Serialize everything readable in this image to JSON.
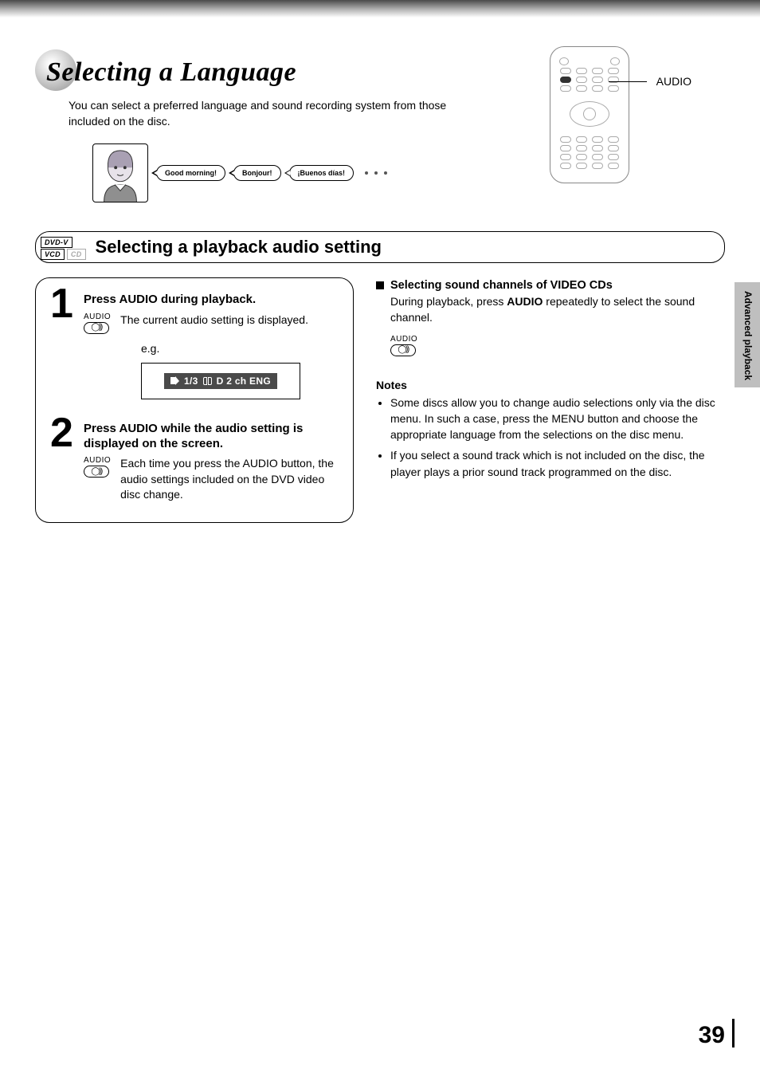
{
  "page": {
    "title": "Selecting a Language",
    "intro": "You can select a preferred language and sound recording system from those included on the disc.",
    "sideTab": "Advanced playback",
    "number": "39"
  },
  "bubbles": [
    "Good morning!",
    "Bonjour!",
    "¡Buenos días!"
  ],
  "remote": {
    "buttonLabel": "AUDIO"
  },
  "section": {
    "title": "Selecting a playback audio setting",
    "badges": {
      "dvdv": "DVD-V",
      "vcd": "VCD",
      "cd": "CD"
    }
  },
  "steps": [
    {
      "num": "1",
      "head": "Press AUDIO during playback.",
      "keyLabel": "AUDIO",
      "text": "The current audio setting is displayed.",
      "eg": "e.g.",
      "osd": {
        "count": "1/3",
        "codec": "D 2 ch ENG"
      }
    },
    {
      "num": "2",
      "head": "Press AUDIO while the audio setting is displayed on the screen.",
      "keyLabel": "AUDIO",
      "text": "Each time you press the AUDIO button, the audio settings included on the DVD video disc change."
    }
  ],
  "right": {
    "subhead": "Selecting sound channels of VIDEO CDs",
    "subtext_pre": "During playback, press ",
    "subtext_bold": "AUDIO",
    "subtext_post": " repeatedly to select the sound channel.",
    "keyLabel": "AUDIO",
    "notesHead": "Notes",
    "notes": [
      "Some discs allow you to change audio selections only via the disc menu.  In such a case, press the MENU button and choose the appropriate language from the selections on the disc menu.",
      "If you select a sound track which is not included on the disc, the player plays a prior sound track programmed on the disc."
    ]
  }
}
